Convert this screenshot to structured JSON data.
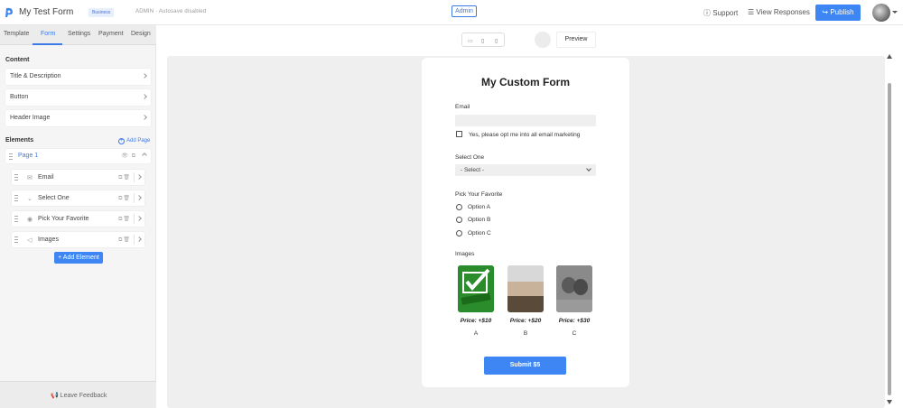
{
  "header": {
    "app_title": "My Test Form",
    "plan_badge": "Business",
    "admin_status": "ADMIN · Autosave disabled",
    "admin_tag": "Admin",
    "support": "Support",
    "view_responses": "View Responses",
    "publish": "Publish"
  },
  "sidebar": {
    "tabs": [
      "Template",
      "Form",
      "Settings",
      "Payment",
      "Design"
    ],
    "active_tab": "Form",
    "content_title": "Content",
    "content_items": [
      "Title & Description",
      "Button",
      "Header Image"
    ],
    "elements_title": "Elements",
    "add_page": "Add Page",
    "page_label": "Page 1",
    "elements": [
      {
        "label": "Email",
        "icon": "mail-icon"
      },
      {
        "label": "Select One",
        "icon": "chevron-down-icon"
      },
      {
        "label": "Pick Your Favorite",
        "icon": "radio-icon"
      },
      {
        "label": "Images",
        "icon": "image-icon"
      }
    ],
    "add_element": "+ Add Element",
    "feedback": "Leave Feedback"
  },
  "toolbar": {
    "preview": "Preview"
  },
  "form": {
    "title": "My Custom Form",
    "email_label": "Email",
    "email_value": "",
    "opt_in": "Yes, please opt me into all email marketing",
    "select_label": "Select One",
    "select_value": "- Select -",
    "radio_label": "Pick Your Favorite",
    "options": [
      "Option A",
      "Option B",
      "Option C"
    ],
    "images_label": "Images",
    "images": [
      {
        "price": "Price: +$10",
        "caption": "A"
      },
      {
        "price": "Price: +$20",
        "caption": "B"
      },
      {
        "price": "Price: +$30",
        "caption": "C"
      }
    ],
    "submit": "Submit $5"
  },
  "colors": {
    "accent": "#3d86f4",
    "link": "#3d7ae6",
    "canvas": "#efefef"
  }
}
